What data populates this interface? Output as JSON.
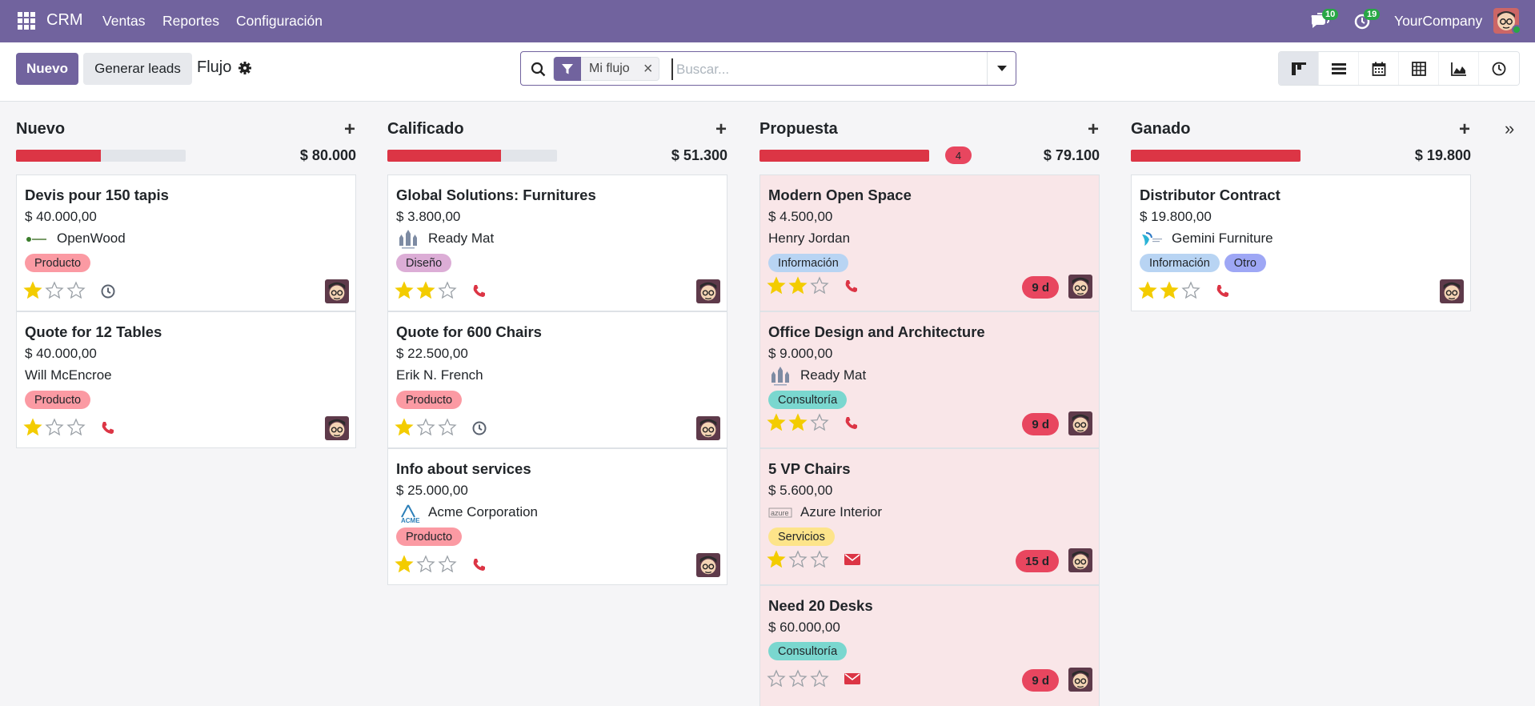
{
  "navbar": {
    "brand": "CRM",
    "menu": [
      "Ventas",
      "Reportes",
      "Configuración"
    ],
    "messages_count": "10",
    "activities_count": "19",
    "company": "YourCompany"
  },
  "control": {
    "new_label": "Nuevo",
    "generate_label": "Generar leads",
    "breadcrumb": "Flujo",
    "facet_label": "Mi flujo",
    "search_placeholder": "Buscar..."
  },
  "columns": [
    {
      "title": "Nuevo",
      "total": "$ 80.000",
      "progress": 0.5,
      "cards": [
        {
          "title": "Devis pour 150 tapis",
          "amount": "$ 40.000,00",
          "partner": "OpenWood",
          "logo": "openwood",
          "tags": [
            {
              "label": "Producto",
              "color": "#fb9aa3"
            }
          ],
          "stars": 1,
          "activity": "clock",
          "days": ""
        },
        {
          "title": "Quote for 12 Tables",
          "amount": "$ 40.000,00",
          "partner": "Will McEncroe",
          "logo": "",
          "tags": [
            {
              "label": "Producto",
              "color": "#fb9aa3"
            }
          ],
          "stars": 1,
          "activity": "phone",
          "days": ""
        }
      ]
    },
    {
      "title": "Calificado",
      "total": "$ 51.300",
      "progress": 0.67,
      "cards": [
        {
          "title": "Global Solutions: Furnitures",
          "amount": "$ 3.800,00",
          "partner": "Ready Mat",
          "logo": "readymat",
          "tags": [
            {
              "label": "Diseño",
              "color": "#dcadd6"
            }
          ],
          "stars": 2,
          "activity": "phone",
          "days": ""
        },
        {
          "title": "Quote for 600 Chairs",
          "amount": "$ 22.500,00",
          "partner": "Erik N. French",
          "logo": "",
          "tags": [
            {
              "label": "Producto",
              "color": "#fb9aa3"
            }
          ],
          "stars": 1,
          "activity": "clock",
          "days": ""
        },
        {
          "title": "Info about services",
          "amount": "$ 25.000,00",
          "partner": "Acme Corporation",
          "logo": "acme",
          "tags": [
            {
              "label": "Producto",
              "color": "#fb9aa3"
            }
          ],
          "stars": 1,
          "activity": "phone",
          "days": ""
        }
      ]
    },
    {
      "title": "Propuesta",
      "total": "$ 79.100",
      "count": "4",
      "progress": 1.0,
      "cards": [
        {
          "title": "Modern Open Space",
          "amount": "$ 4.500,00",
          "partner": "Henry Jordan",
          "logo": "",
          "tags": [
            {
              "label": "Información",
              "color": "#b8d4f3"
            }
          ],
          "stars": 2,
          "activity": "phone",
          "days": "9 d"
        },
        {
          "title": "Office Design and Architecture",
          "amount": "$ 9.000,00",
          "partner": "Ready Mat",
          "logo": "readymat",
          "tags": [
            {
              "label": "Consultoría",
              "color": "#7ad7cf"
            }
          ],
          "stars": 2,
          "activity": "phone",
          "days": "9 d"
        },
        {
          "title": "5 VP Chairs",
          "amount": "$ 5.600,00",
          "partner": "Azure Interior",
          "logo": "azure",
          "tags": [
            {
              "label": "Servicios",
              "color": "#fde48a"
            }
          ],
          "stars": 1,
          "activity": "email",
          "days": "15 d"
        },
        {
          "title": "Need 20 Desks",
          "amount": "$ 60.000,00",
          "partner": "",
          "logo": "",
          "tags": [
            {
              "label": "Consultoría",
              "color": "#7ad7cf"
            }
          ],
          "stars": 0,
          "activity": "email",
          "days": "9 d"
        }
      ]
    },
    {
      "title": "Ganado",
      "total": "$ 19.800",
      "progress": 1.0,
      "cards": [
        {
          "title": "Distributor Contract",
          "amount": "$ 19.800,00",
          "partner": "Gemini Furniture",
          "logo": "gemini",
          "tags": [
            {
              "label": "Información",
              "color": "#b8d4f3"
            },
            {
              "label": "Otro",
              "color": "#9ea7f5"
            }
          ],
          "stars": 2,
          "activity": "phone",
          "days": ""
        }
      ]
    }
  ],
  "colors": {
    "brand": "#71639e",
    "danger": "#dc3545",
    "star": "#f3cc00"
  }
}
